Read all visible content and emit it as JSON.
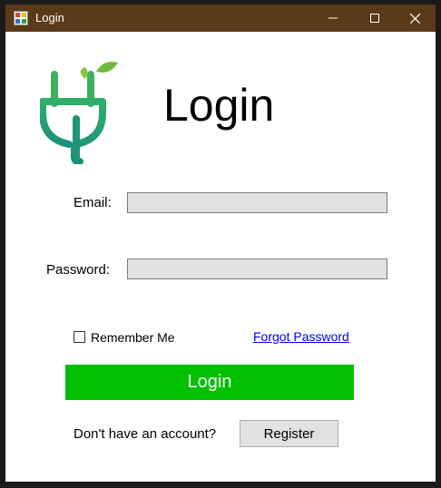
{
  "window": {
    "title": "Login",
    "title_bar_color": "#5b3a1a",
    "app_icon": "form-icon",
    "controls": {
      "minimize": "minimize-icon",
      "maximize": "maximize-icon",
      "close": "close-icon"
    }
  },
  "header": {
    "logo": "plug-leaf-logo",
    "heading": "Login"
  },
  "form": {
    "email_label": "Email:",
    "email_value": "",
    "password_label": "Password:",
    "password_value": "",
    "remember_label": "Remember Me",
    "remember_checked": false,
    "forgot_link": "Forgot Password",
    "login_button": "Login",
    "login_button_color": "#00c000",
    "no_account_text": "Don't have an account?",
    "register_button": "Register"
  }
}
